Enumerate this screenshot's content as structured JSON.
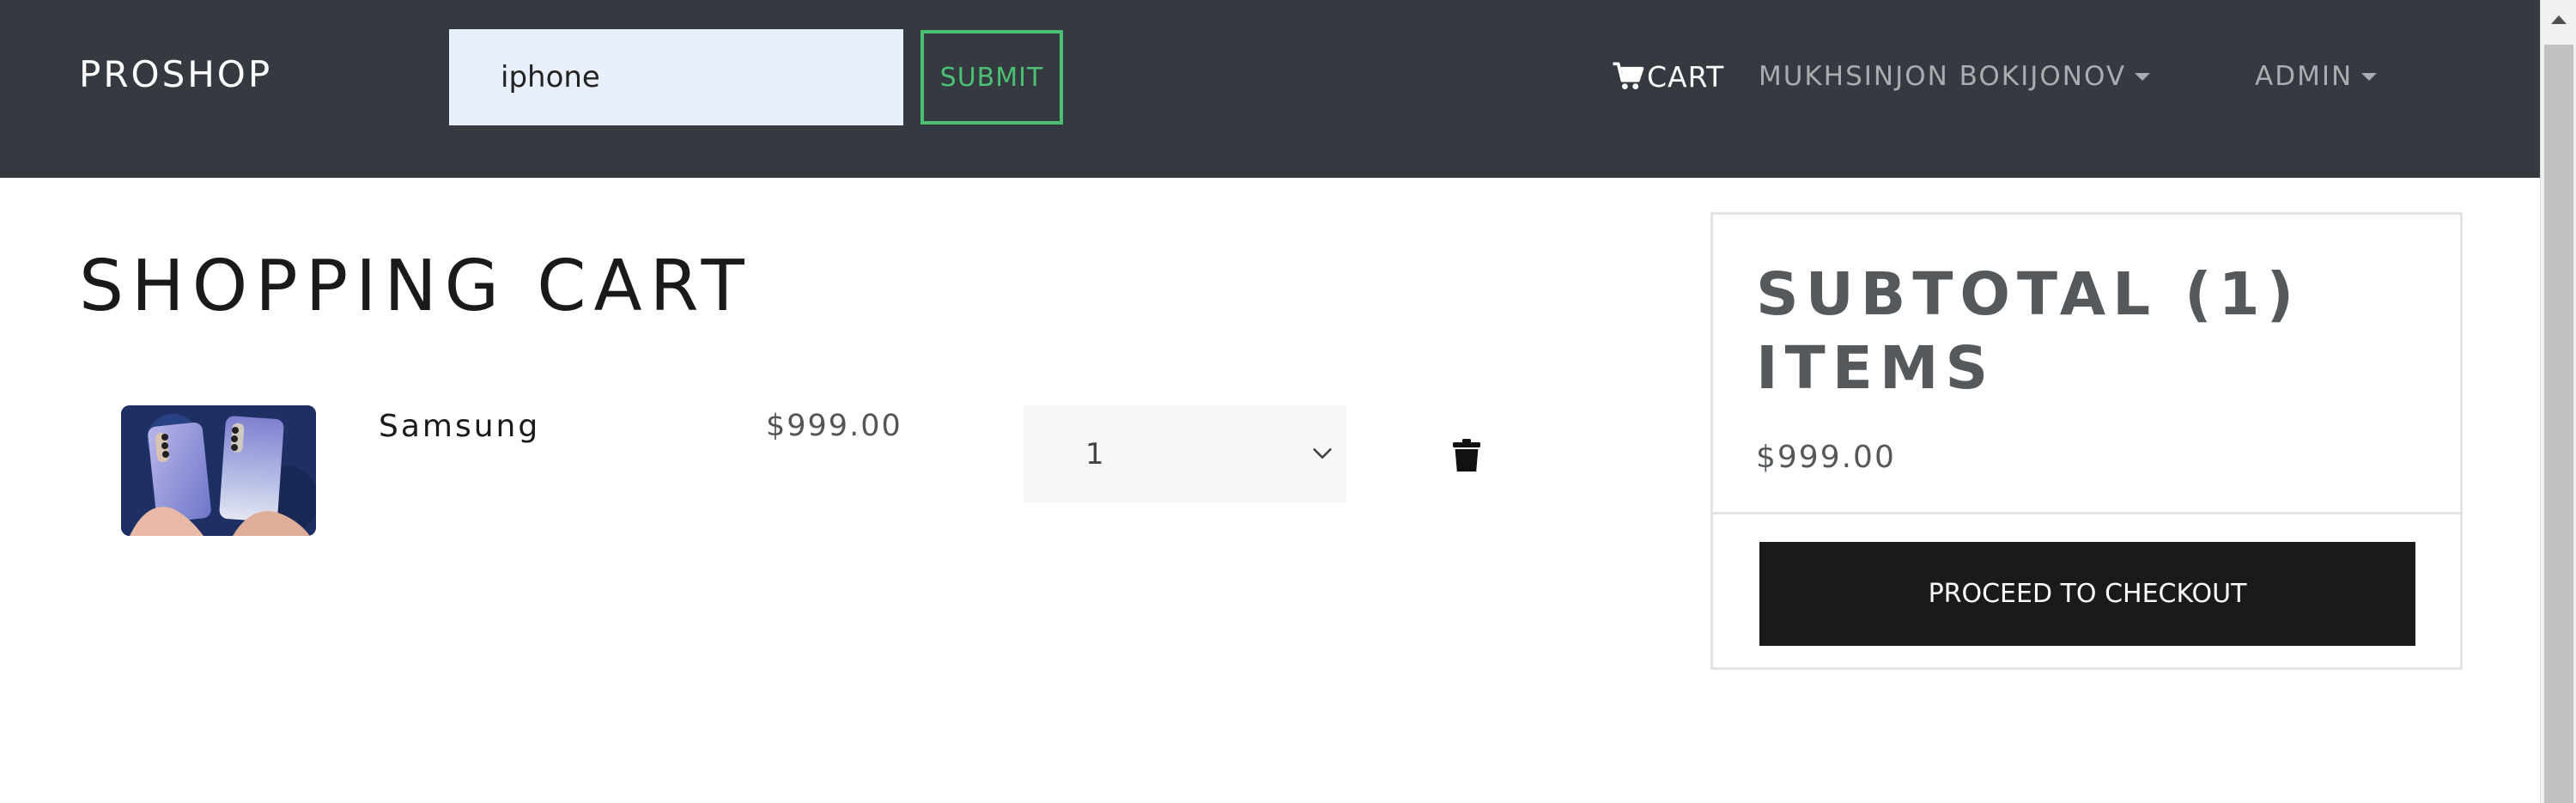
{
  "navbar": {
    "brand": "PROSHOP",
    "search": {
      "value": "iphone",
      "placeholder": ""
    },
    "submit_label": "SUBMIT",
    "cart_label": "CART",
    "user_label": "MUKHSINJON BOKIJONOV",
    "admin_label": "ADMIN",
    "bg_color": "#343a40",
    "accent_color": "#4bbf73"
  },
  "main": {
    "title": "SHOPPING CART",
    "items": [
      {
        "name": "Samsung",
        "price": "$999.00",
        "qty": "1",
        "image_icon": "phone-photo"
      }
    ]
  },
  "summary": {
    "title": "SUBTOTAL (1) ITEMS",
    "total": "$999.00",
    "checkout_label": "PROCEED TO CHECKOUT"
  }
}
